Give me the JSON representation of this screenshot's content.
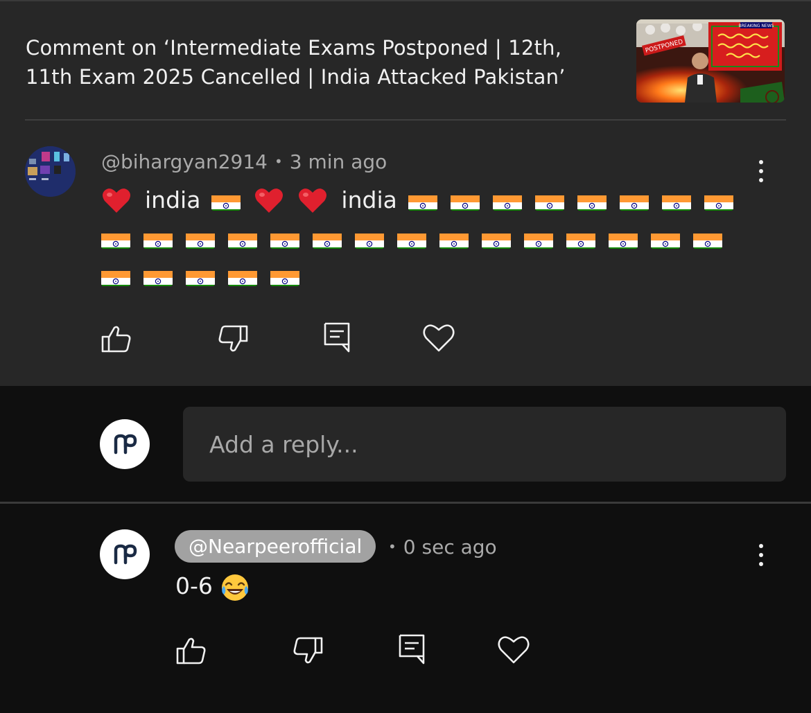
{
  "header": {
    "title": "Comment on ‘Intermediate Exams Postponed | 12th, 11th Exam 2025 Cancelled | India Attacked Pakistan’",
    "thumbnail": {
      "badge": "POSTPONED",
      "tag": "BREAKING NEWS"
    }
  },
  "comment": {
    "author": "@bihargyan2914",
    "time": "3 min ago",
    "words": [
      "india",
      "india"
    ],
    "emoji_sequence": "heart, word, flag, heart, heart, word, flag×28",
    "flag_count": 28
  },
  "actions": {
    "like": "thumbs-up-icon",
    "dislike": "thumbs-down-icon",
    "reply": "comment-icon",
    "love": "heart-outline-icon"
  },
  "reply_box": {
    "placeholder": "Add a reply..."
  },
  "reply": {
    "author": "@Nearpeerofficial",
    "time": "0 sec ago",
    "text": "0-6"
  },
  "colors": {
    "panel": "#272727",
    "background": "#0f0f0f",
    "text": "#f1f1f1",
    "muted": "#aaaaaa",
    "pill": "#a2a2a2",
    "heart_red": "#e0202e",
    "saffron": "#ff9933",
    "green": "#138808",
    "chakra": "#000080"
  }
}
